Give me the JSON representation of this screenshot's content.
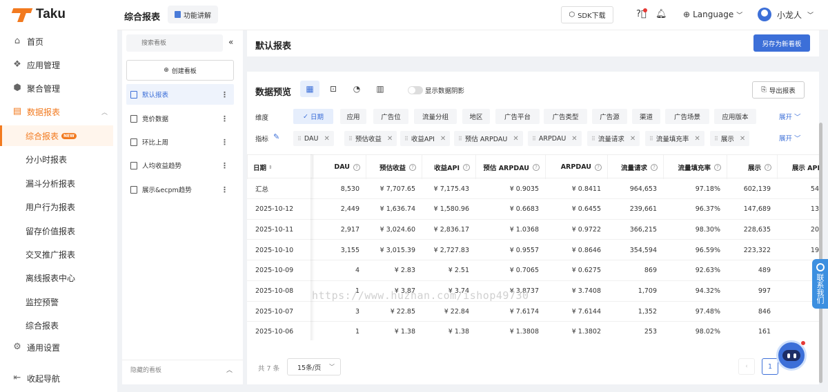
{
  "app": {
    "logo_text": "Taku"
  },
  "nav": {
    "items": [
      {
        "label": "首页",
        "icon": "home-icon"
      },
      {
        "label": "应用管理",
        "icon": "apps-icon"
      },
      {
        "label": "聚合管理",
        "icon": "mediation-icon"
      },
      {
        "label": "数据报表",
        "icon": "report-icon"
      }
    ],
    "sub_items": [
      "综合报表",
      "分小时报表",
      "漏斗分析报表",
      "用户行为报表",
      "留存价值报表",
      "交叉推广报表",
      "离线报表中心",
      "监控预警",
      "综合报表"
    ],
    "new_badge": "NEW",
    "settings": "通用设置",
    "collapse": "收起导航"
  },
  "topbar": {
    "title": "综合报表",
    "func_btn": "功能讲解",
    "sdk_btn": "SDK下载",
    "language": "Language",
    "user": "小龙人"
  },
  "board": {
    "search_placeholder": "搜索看板",
    "create": "创建看板",
    "items": [
      "默认报表",
      "竞价数据",
      "环比上周",
      "人均收益趋势",
      "展示&ecpm趋势"
    ],
    "hidden": "隐藏的看板"
  },
  "report": {
    "title": "默认报表",
    "save_as": "另存为新看板"
  },
  "preview": {
    "title": "数据预览",
    "toggle_label": "显示数据阴影",
    "export": "导出报表",
    "dim_label": "维度",
    "metric_label": "指标",
    "expand": "展开",
    "dimensions": [
      "日期",
      "应用",
      "广告位",
      "流量分组",
      "地区",
      "广告平台",
      "广告类型",
      "广告源",
      "渠道",
      "广告场景",
      "应用版本"
    ],
    "metrics": [
      "DAU",
      "预估收益",
      "收益API",
      "预估 ARPDAU",
      "ARPDAU",
      "流量请求",
      "流量填充率",
      "展示"
    ]
  },
  "table": {
    "columns": [
      "日期",
      "DAU",
      "预估收益",
      "收益API",
      "预估 ARPDAU",
      "ARPDAU",
      "流量请求",
      "流量填充率",
      "展示",
      "展示 API"
    ],
    "rows": [
      [
        "汇总",
        "8,530",
        "¥ 7,707.65",
        "¥ 7,175.43",
        "¥ 0.9035",
        "¥ 0.8411",
        "964,653",
        "97.18%",
        "602,139",
        "54"
      ],
      [
        "2025-10-12",
        "2,449",
        "¥ 1,636.74",
        "¥ 1,580.96",
        "¥ 0.6683",
        "¥ 0.6455",
        "239,661",
        "96.37%",
        "147,689",
        "13"
      ],
      [
        "2025-10-11",
        "2,917",
        "¥ 3,024.60",
        "¥ 2,836.17",
        "¥ 1.0368",
        "¥ 0.9722",
        "366,215",
        "98.30%",
        "228,635",
        "20"
      ],
      [
        "2025-10-10",
        "3,155",
        "¥ 3,015.39",
        "¥ 2,727.83",
        "¥ 0.9557",
        "¥ 0.8646",
        "354,594",
        "96.59%",
        "223,322",
        "19"
      ],
      [
        "2025-10-09",
        "4",
        "¥ 2.83",
        "¥ 2.51",
        "¥ 0.7065",
        "¥ 0.6275",
        "869",
        "92.63%",
        "489",
        ""
      ],
      [
        "2025-10-08",
        "1",
        "¥ 3.87",
        "¥ 3.74",
        "¥ 3.8737",
        "¥ 3.7408",
        "1,709",
        "94.32%",
        "997",
        ""
      ],
      [
        "2025-10-07",
        "3",
        "¥ 22.85",
        "¥ 22.84",
        "¥ 7.6174",
        "¥ 7.6144",
        "1,352",
        "97.48%",
        "846",
        ""
      ],
      [
        "2025-10-06",
        "1",
        "¥ 1.38",
        "¥ 1.38",
        "¥ 1.3808",
        "¥ 1.3802",
        "253",
        "98.02%",
        "161",
        ""
      ]
    ]
  },
  "pagination": {
    "total": "共 7 条",
    "page_size": "15条/页",
    "current": "1"
  },
  "contact": {
    "label": "联系我们"
  },
  "watermark": "https://www.huzhan.com/ishop49730",
  "colors": {
    "brand": "#f27a1f",
    "primary": "#3c6fd8"
  }
}
